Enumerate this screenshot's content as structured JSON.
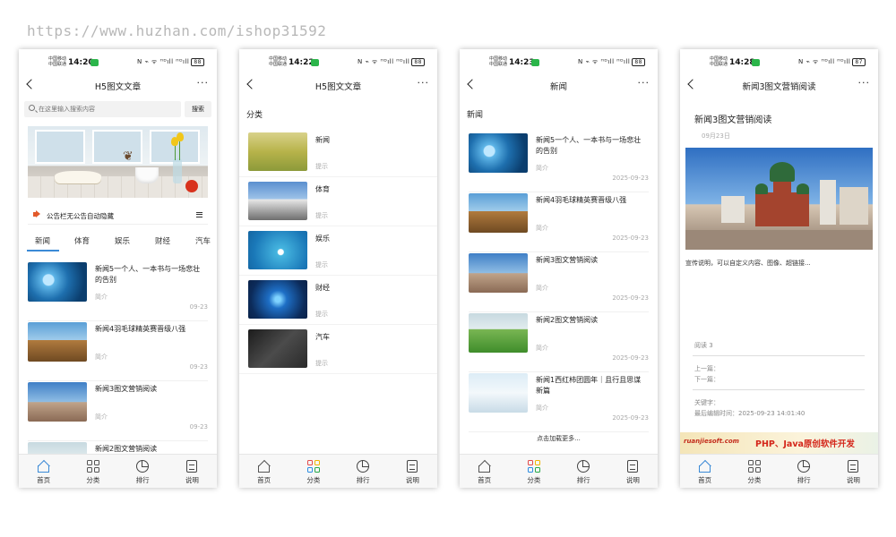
{
  "watermark": "https://www.huzhan.com/ishop31592",
  "status": {
    "carrier_line1": "中国移动",
    "carrier_line2": "中国联通",
    "sys_icons": "N ⌁ ᯤ ᴴᴰıll ᴴᴰıll",
    "times": [
      "14:20",
      "14:22",
      "14:23",
      "14:28"
    ],
    "battery": [
      "88",
      "88",
      "88",
      "87"
    ]
  },
  "tabbar": {
    "home": "首页",
    "category": "分类",
    "rank": "排行",
    "about": "说明"
  },
  "screen1": {
    "nav_title": "H5图文文章",
    "search_placeholder": "在这里输入搜索内容",
    "search_button": "搜索",
    "notice": "公告栏无公告自动隐藏",
    "tabs": [
      "新闻",
      "体育",
      "娱乐",
      "财经",
      "汽车"
    ],
    "articles": [
      {
        "title": "新闻5一个人、一本书与一场悲壮的告别",
        "brief": "简介",
        "date": "09-23"
      },
      {
        "title": "新闻4羽毛球精英赛晋级八强",
        "brief": "简介",
        "date": "09-23"
      },
      {
        "title": "新闻3图文营销阅读",
        "brief": "简介",
        "date": "09-23"
      },
      {
        "title": "新闻2图文营销阅读",
        "brief": "",
        "date": ""
      }
    ]
  },
  "screen2": {
    "nav_title": "H5图文文章",
    "header": "分类",
    "categories": [
      {
        "name": "新闻",
        "hint": "提示"
      },
      {
        "name": "体育",
        "hint": "提示"
      },
      {
        "name": "娱乐",
        "hint": "提示"
      },
      {
        "name": "财经",
        "hint": "提示"
      },
      {
        "name": "汽车",
        "hint": "提示"
      }
    ]
  },
  "screen3": {
    "nav_title": "新闻",
    "header": "新闻",
    "articles": [
      {
        "title": "新闻5一个人、一本书与一场悲壮的告别",
        "brief": "简介",
        "date": "2025-09-23"
      },
      {
        "title": "新闻4羽毛球精英赛晋级八强",
        "brief": "简介",
        "date": "2025-09-23"
      },
      {
        "title": "新闻3图文营销阅读",
        "brief": "简介",
        "date": "2025-09-23"
      },
      {
        "title": "新闻2图文营销阅读",
        "brief": "简介",
        "date": "2025-09-23"
      },
      {
        "title": "新闻1西红柿团圆年｜且行且思谋新篇",
        "brief": "简介",
        "date": "2025-09-23"
      }
    ],
    "load_more": "点击加载更多..."
  },
  "screen4": {
    "nav_title": "新闻3图文营销阅读",
    "title": "新闻3图文营销阅读",
    "date": "09月23日",
    "description": "宣传说明，可以自定义内容、图像、超链接...",
    "reads": "阅读 3",
    "prev": "上一篇：",
    "next": "下一篇：",
    "keywords": "关键字：",
    "last_edit": "最后编辑时间：2025-09-23 14:01:40",
    "ad_left": "ruanjiesoft.com",
    "ad_right": "PHP、Java原创软件开发"
  }
}
